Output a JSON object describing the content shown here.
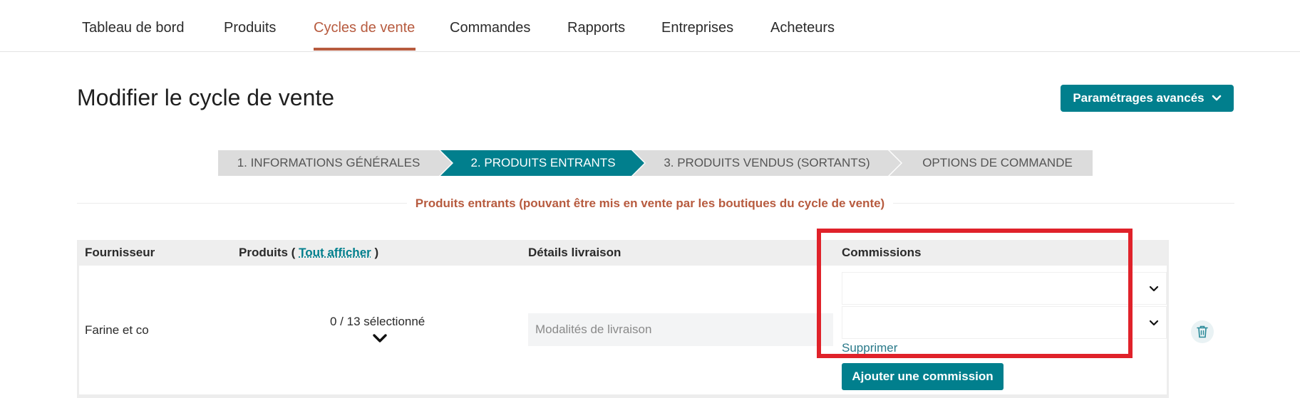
{
  "nav": {
    "items": [
      {
        "label": "Tableau de bord"
      },
      {
        "label": "Produits"
      },
      {
        "label": "Cycles de vente",
        "active": true
      },
      {
        "label": "Commandes"
      },
      {
        "label": "Rapports"
      },
      {
        "label": "Entreprises"
      },
      {
        "label": "Acheteurs"
      }
    ]
  },
  "page": {
    "title": "Modifier le cycle de vente",
    "advanced_button": "Paramétrages avancés"
  },
  "stepper": {
    "steps": [
      {
        "label": "1. INFORMATIONS GÉNÉRALES",
        "active": false
      },
      {
        "label": "2. PRODUITS ENTRANTS",
        "active": true
      },
      {
        "label": "3. PRODUITS VENDUS (SORTANTS)",
        "active": false
      },
      {
        "label": "OPTIONS DE COMMANDE",
        "active": false
      }
    ]
  },
  "section": {
    "title": "Produits entrants (pouvant être mis en vente par les boutiques du cycle de vente)"
  },
  "table": {
    "headers": {
      "supplier": "Fournisseur",
      "products_prefix": "Produits (",
      "products_link": "Tout afficher",
      "products_suffix": ")",
      "delivery": "Détails livraison",
      "commissions": "Commissions"
    },
    "rows": [
      {
        "supplier": "Farine et co",
        "products_selected": "0 / 13 sélectionné",
        "delivery_placeholder": "Modalités de livraison",
        "commissions": [
          "",
          ""
        ],
        "delete_link": "Supprimer",
        "add_commission": "Ajouter une commission"
      }
    ]
  },
  "colors": {
    "accent": "#017f8d",
    "active_nav": "#b75b3f",
    "highlight": "#e0222a"
  }
}
